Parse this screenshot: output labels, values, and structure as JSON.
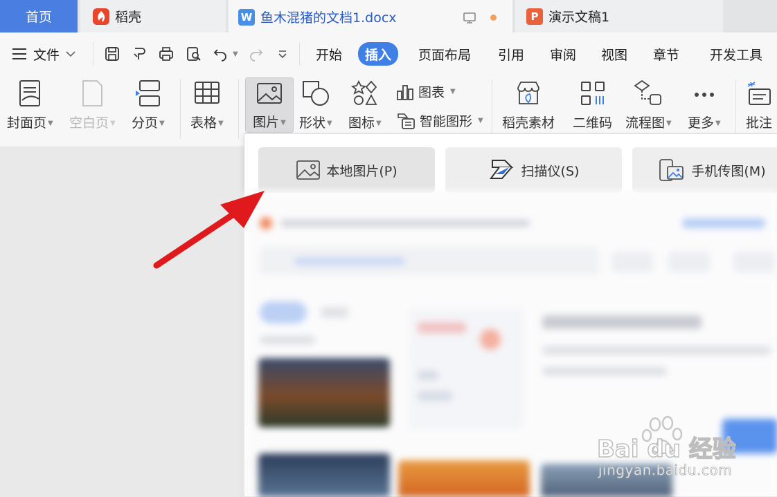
{
  "tabs": {
    "home": "首页",
    "daoke": "稻壳",
    "doc": "鱼木混猪的文档1.docx",
    "ppt": "演示文稿1"
  },
  "menu": {
    "file": "文件",
    "items": [
      "开始",
      "插入",
      "页面布局",
      "引用",
      "审阅",
      "视图",
      "章节",
      "开发工具"
    ],
    "active": "插入"
  },
  "ribbon": {
    "cover": "封面页",
    "blank": "空白页",
    "pagebreak": "分页",
    "table": "表格",
    "picture": "图片",
    "shape": "形状",
    "icon": "图标",
    "chart": "图表",
    "smartart": "智能图形",
    "material": "稻壳素材",
    "qrcode": "二维码",
    "flowchart": "流程图",
    "more": "更多",
    "comment": "批注"
  },
  "dropdown": {
    "local": "本地图片(P)",
    "scanner": "扫描仪(S)",
    "phone": "手机传图(M)"
  },
  "watermark": {
    "brand": "Bai du 经验",
    "url": "jingyan.baidu.com"
  },
  "colors": {
    "accent": "#3f80e6",
    "home_tab": "#4a7ee0",
    "daoke_red": "#e8452b",
    "word_blue": "#4a8fe6",
    "ppt_orange": "#e9623c",
    "arrow_red": "#e0191c"
  }
}
